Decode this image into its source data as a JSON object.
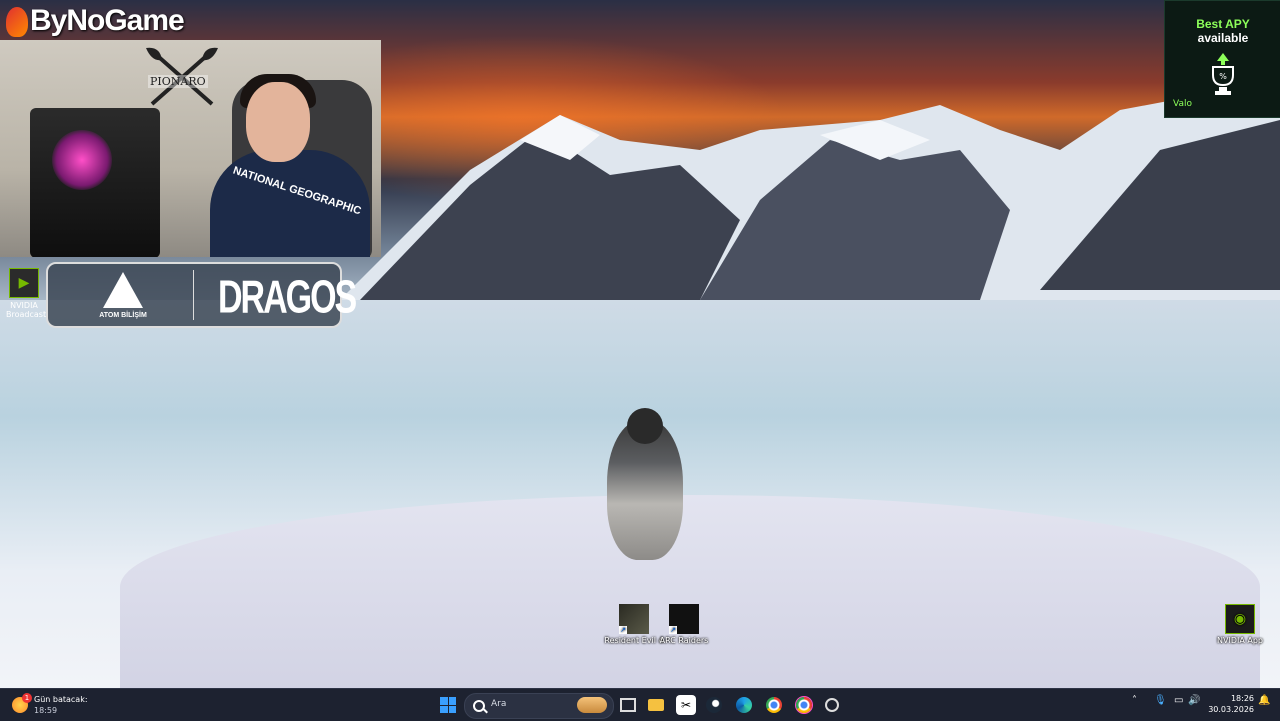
{
  "overlay": {
    "logo": "ByNoGame",
    "webcam_emblem": "PIONARO",
    "shirt_text": "NATIONAL GEOGRAPHIC",
    "nvidia_broadcast_label": "NVIDIA Broadcast",
    "sponsor_left": "ATOM BİLİŞİM",
    "sponsor_right": "DRAGOS",
    "ad": {
      "line1": "Best APY",
      "line2": "available",
      "brand": "Valo",
      "badge": "%"
    }
  },
  "desktop_icons": [
    {
      "label": "Resident Evil 4",
      "icon": "resident-evil-4-icon"
    },
    {
      "label": "ARC Raiders",
      "icon": "arc-raiders-icon"
    },
    {
      "label": "NVIDIA App",
      "icon": "nvidia-app-icon"
    }
  ],
  "taskbar": {
    "weather_title": "Gün batacak:",
    "weather_time": "18:59",
    "weather_badge": "1",
    "search_placeholder": "Ara",
    "pinned": [
      "task-view-icon",
      "file-explorer-icon",
      "capcut-icon",
      "steam-icon",
      "edge-icon",
      "chrome-icon",
      "chrome-profile-icon",
      "obs-icon"
    ],
    "clock_time": "18:26",
    "clock_date": "30.03.2026"
  }
}
